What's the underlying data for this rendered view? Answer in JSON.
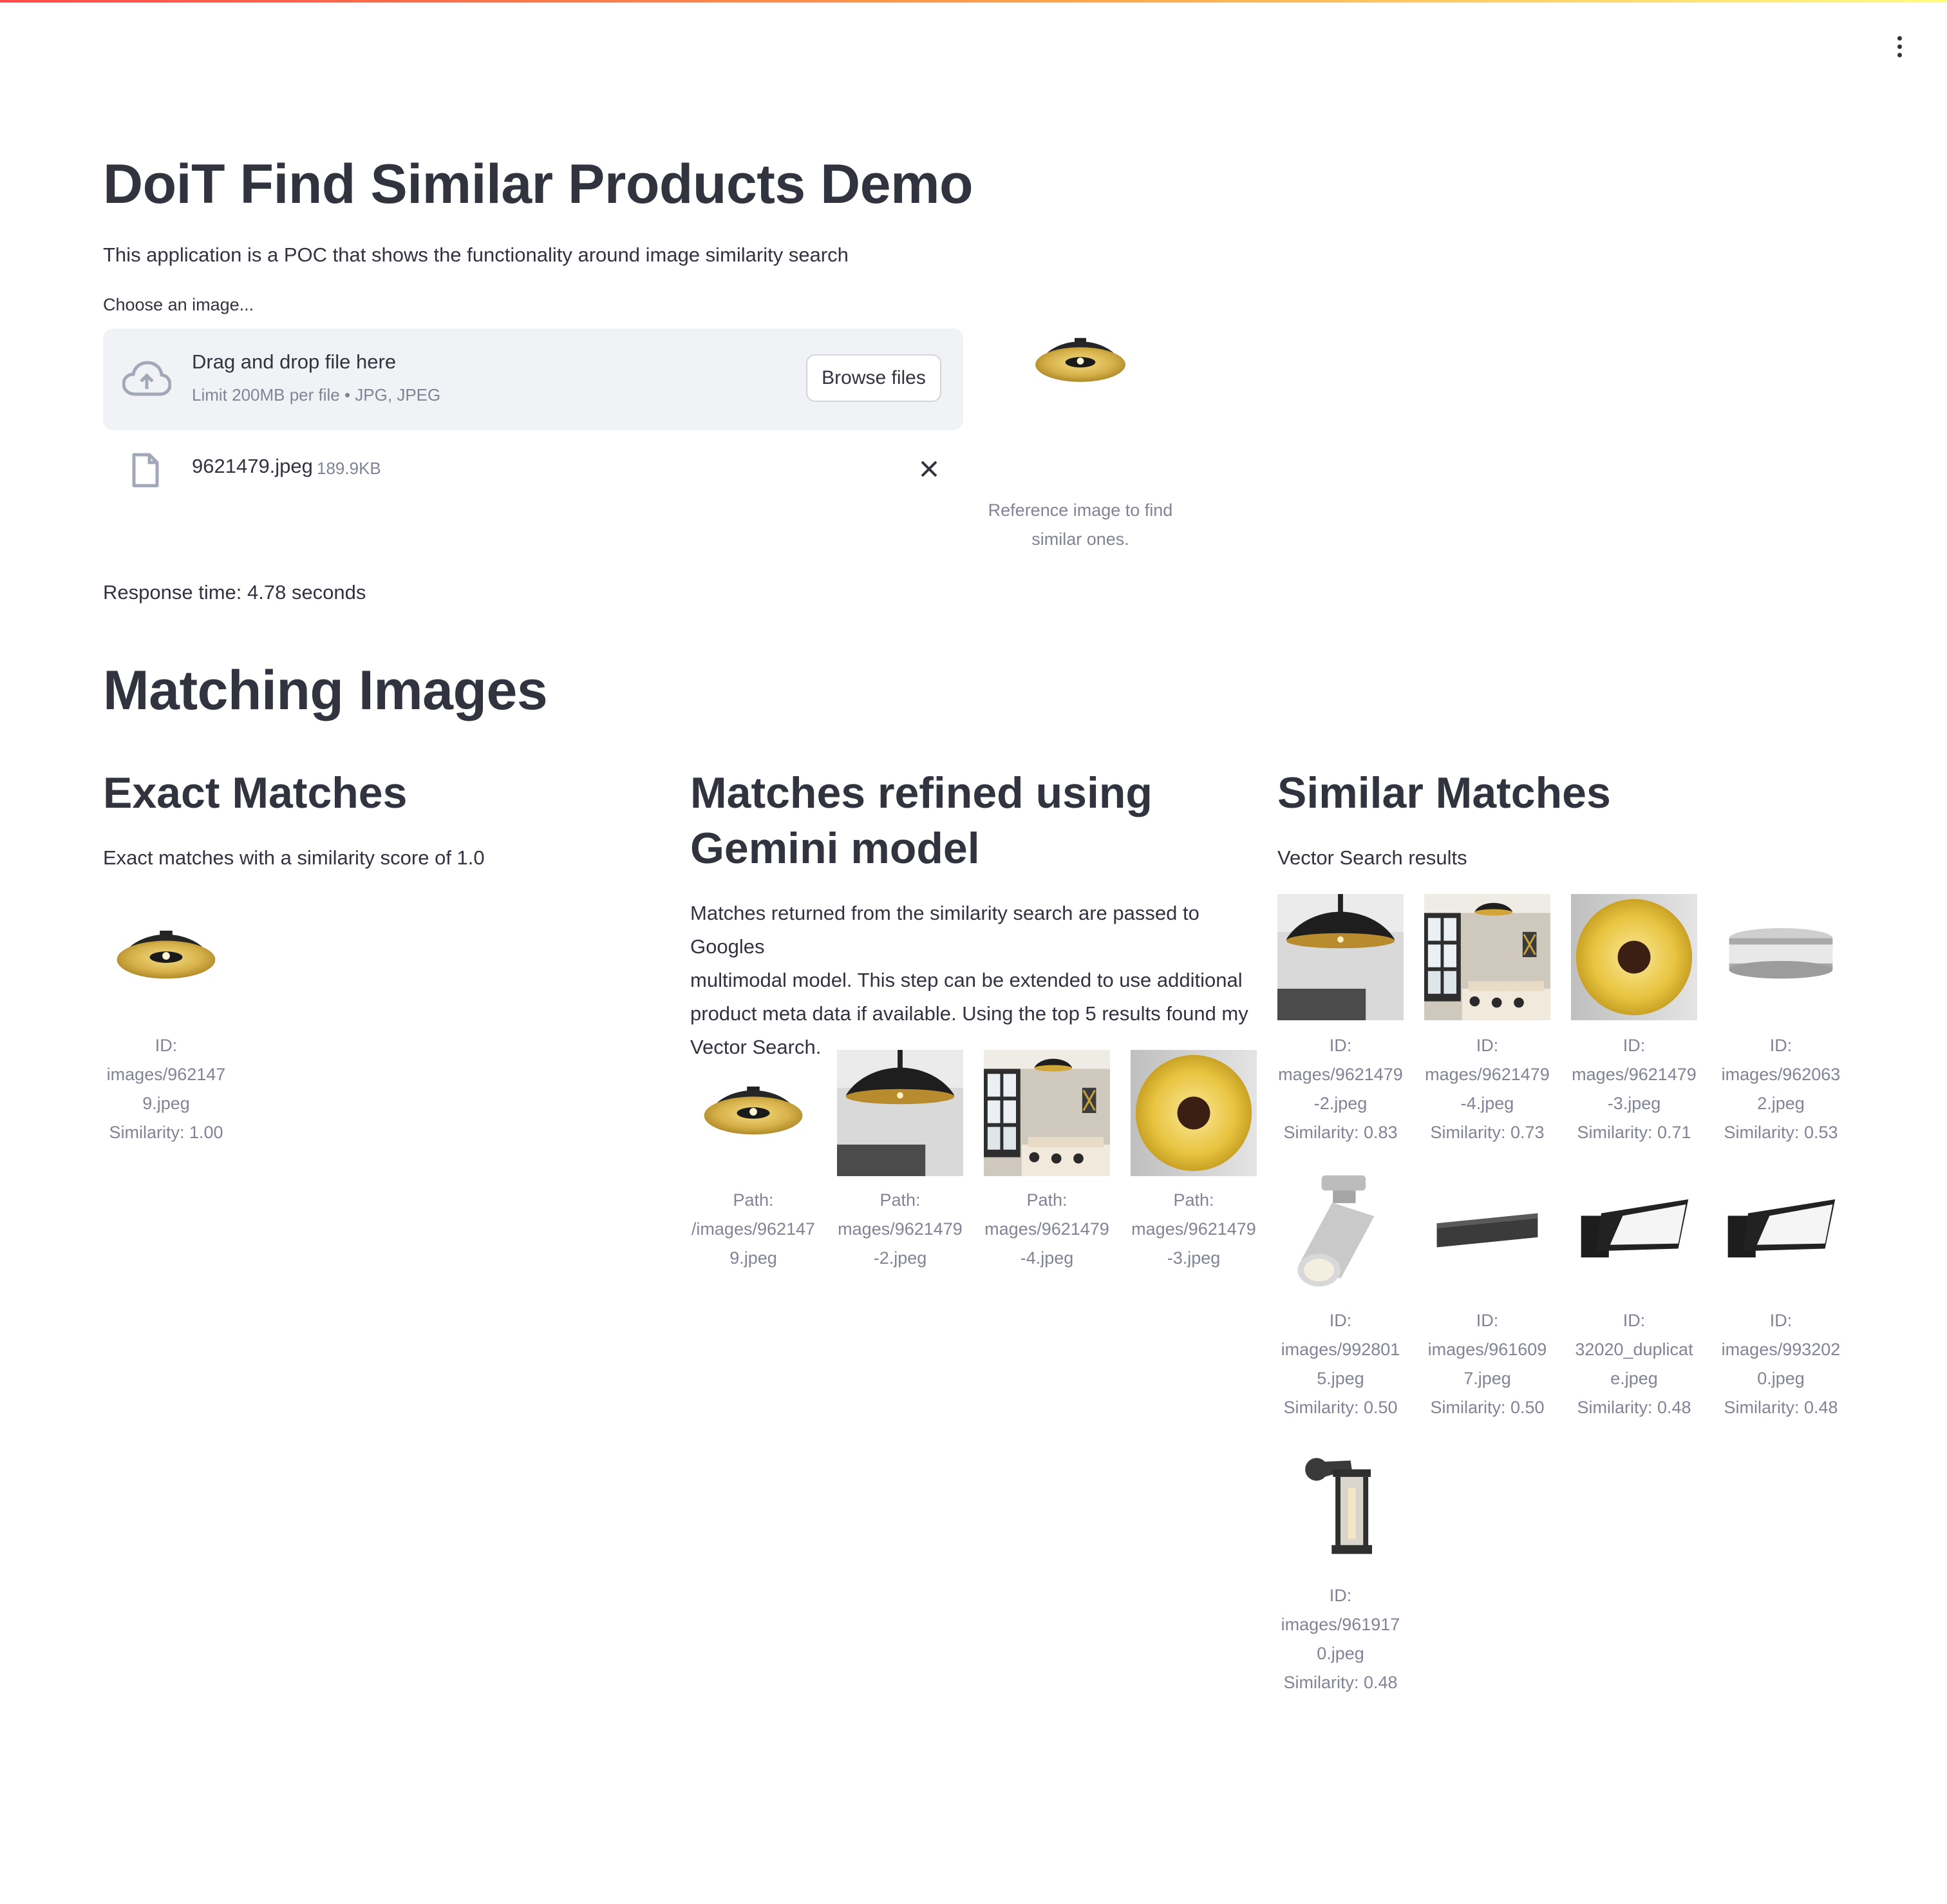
{
  "app": {
    "title": "DoiT Find Similar Products Demo",
    "description": "This application is a POC that shows the functionality around image similarity search"
  },
  "uploader": {
    "label": "Choose an image...",
    "drop_text": "Drag and drop file here",
    "limit_text": "Limit 200MB per file • JPG, JPEG",
    "browse_label": "Browse files",
    "file_name": "9621479.jpeg",
    "file_size": "189.9KB"
  },
  "reference": {
    "caption_line1": "Reference image to find",
    "caption_line2": "similar ones."
  },
  "response_time": "Response time: 4.78 seconds",
  "matching": {
    "title": "Matching Images",
    "exact": {
      "title": "Exact Matches",
      "description": "Exact matches with a similarity score of 1.0",
      "items": [
        {
          "lines": [
            "ID:",
            "images/962147",
            "9.jpeg",
            "Similarity: 1.00"
          ],
          "icon": "dome-lamp-icon"
        }
      ]
    },
    "refined": {
      "title_line1": "Matches refined using",
      "title_line2": "Gemini model",
      "description_lines": [
        "Matches returned from the similarity search are passed to Googles",
        "multimodal model. This step can be extended to use additional",
        "product meta data if available. Using the top 5 results found my",
        "Vector Search."
      ],
      "items": [
        {
          "lines": [
            "Path:",
            "/images/962147",
            "9.jpeg"
          ],
          "icon": "dome-lamp-icon"
        },
        {
          "lines": [
            "Path:",
            "mages/9621479",
            "-2.jpeg"
          ],
          "icon": "dome-lamp-room-icon"
        },
        {
          "lines": [
            "Path:",
            "mages/9621479",
            "-4.jpeg"
          ],
          "icon": "dining-room-icon"
        },
        {
          "lines": [
            "Path:",
            "mages/9621479",
            "-3.jpeg"
          ],
          "icon": "gold-disc-lamp-icon"
        }
      ]
    },
    "similar": {
      "title": "Similar Matches",
      "description": "Vector Search results",
      "items": [
        {
          "lines": [
            "ID:",
            "mages/9621479",
            "-2.jpeg",
            "Similarity: 0.83"
          ],
          "icon": "dome-lamp-room-icon"
        },
        {
          "lines": [
            "ID:",
            "mages/9621479",
            "-4.jpeg",
            "Similarity: 0.73"
          ],
          "icon": "dining-room-icon"
        },
        {
          "lines": [
            "ID:",
            "mages/9621479",
            "-3.jpeg",
            "Similarity: 0.71"
          ],
          "icon": "gold-disc-lamp-icon"
        },
        {
          "lines": [
            "ID:",
            "images/962063",
            "2.jpeg",
            "Similarity: 0.53"
          ],
          "icon": "flush-ceiling-lamp-icon"
        },
        {
          "lines": [
            "ID:",
            "images/992801",
            "5.jpeg",
            "Similarity: 0.50"
          ],
          "icon": "spot-lamp-icon"
        },
        {
          "lines": [
            "ID:",
            "images/961609",
            "7.jpeg",
            "Similarity: 0.50"
          ],
          "icon": "linear-lamp-icon"
        },
        {
          "lines": [
            "ID:",
            "32020_duplicat",
            "e.jpeg",
            "Similarity: 0.48"
          ],
          "icon": "wall-panel-lamp-icon"
        },
        {
          "lines": [
            "ID:",
            "images/993202",
            "0.jpeg",
            "Similarity: 0.48"
          ],
          "icon": "wall-panel-lamp-icon"
        },
        {
          "lines": [
            "ID:",
            "images/961917",
            "0.jpeg",
            "Similarity: 0.48"
          ],
          "icon": "lantern-wall-lamp-icon"
        }
      ]
    }
  },
  "colors": {
    "text": "#31333f",
    "muted": "#808495",
    "uploader_bg": "#f0f2f6",
    "accent_gold": "#c9a23a",
    "lamp_black": "#1f1f1f"
  }
}
